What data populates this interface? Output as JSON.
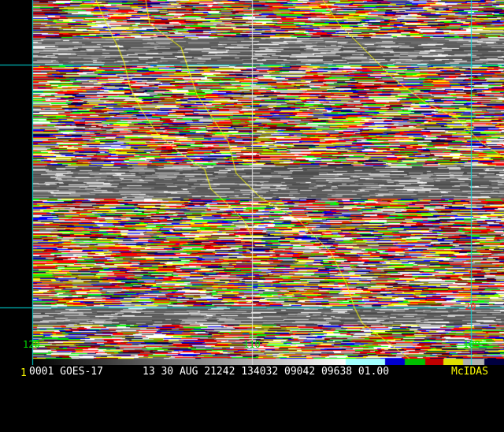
{
  "image": {
    "satellite": "GOES-17",
    "colors": {
      "grid": "#00e0e0",
      "coast": "#ffff00",
      "lon_label": "#00e000",
      "lat_label": "#ff2020"
    }
  },
  "grid_labels": {
    "lon_120": "120",
    "lon_110": "110",
    "lon_100": "100",
    "lat_20": "20"
  },
  "status_bar": {
    "frame": "1",
    "id_sat": "0001 GOES-17",
    "info": "13 30 AUG 21242 134032 09042 09638 01.00",
    "brand": "McIDAS"
  }
}
